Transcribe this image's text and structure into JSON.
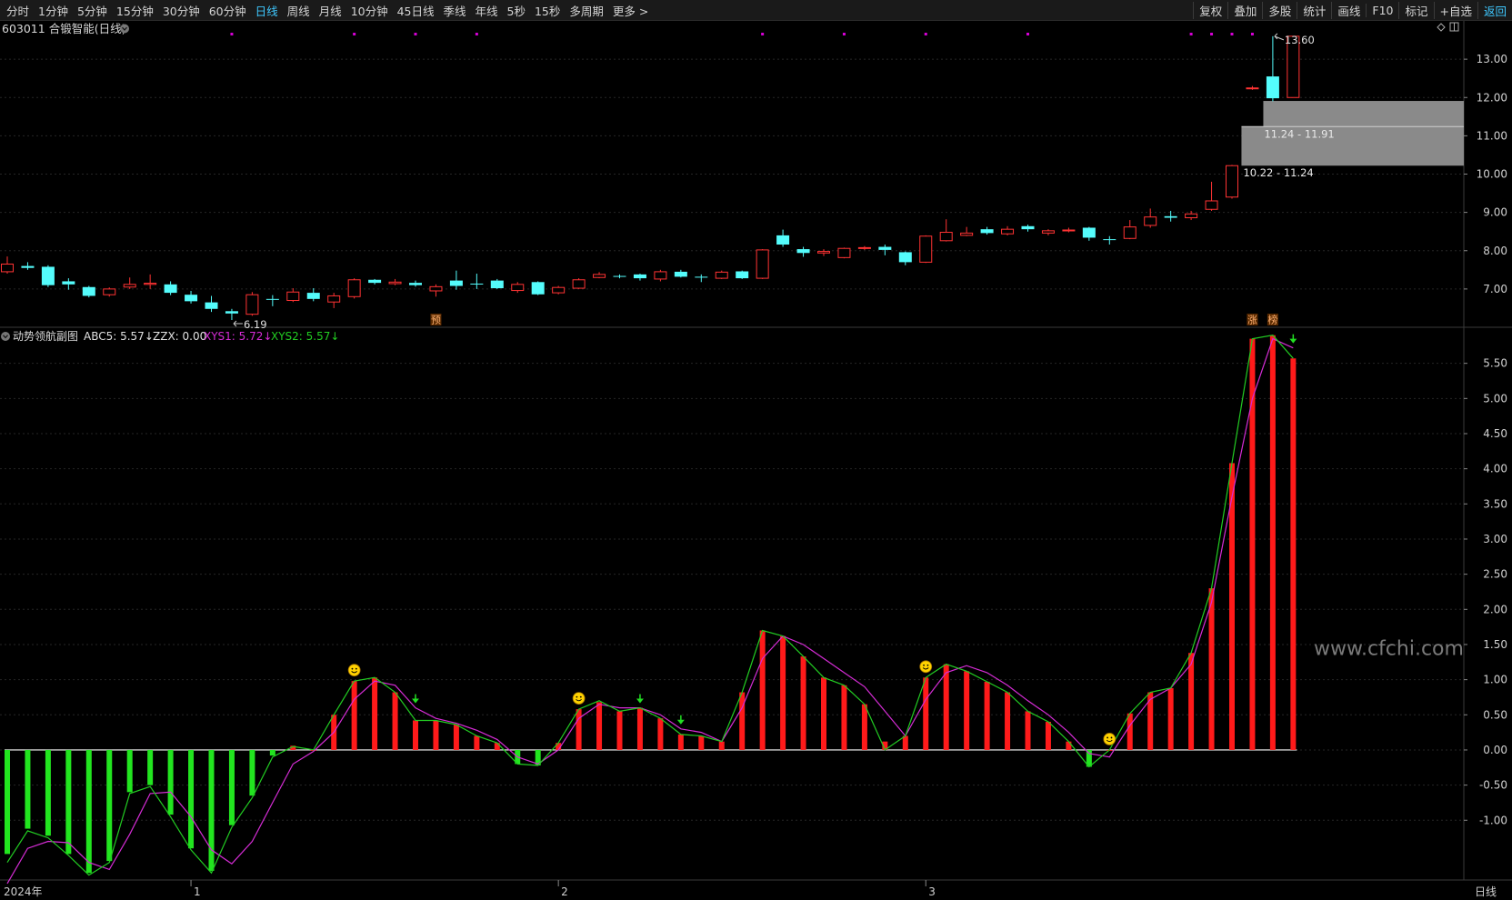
{
  "toolbar": {
    "timeframes": [
      "分时",
      "1分钟",
      "5分钟",
      "15分钟",
      "30分钟",
      "60分钟",
      "日线",
      "周线",
      "月线",
      "10分钟",
      "45日线",
      "季线",
      "年线",
      "5秒",
      "15秒",
      "多周期",
      "更多 >"
    ],
    "active_timeframe": "日线",
    "tools": [
      "复权",
      "叠加",
      "多股",
      "统计",
      "画线",
      "F10",
      "标记",
      "+自选",
      "返回"
    ]
  },
  "stock": {
    "title": "603011 合锻智能(日线)"
  },
  "colors": {
    "up": "#ff3333",
    "down": "#54fcfc",
    "bar_up": "#ff1a1a",
    "bar_down": "#22e51f",
    "xys1": "#d52cd5",
    "xys2": "#22cc22",
    "zero_line": "#ffffff",
    "grid": "#262626",
    "marker": "#d400d4"
  },
  "chart_data": [
    {
      "type": "candlestick",
      "title": "603011 合锻智能(日线)",
      "y_ticks": [
        "13.00",
        "12.00",
        "11.00",
        "10.00",
        "9.00",
        "8.00",
        "7.00"
      ],
      "y_ticks_values": [
        13,
        12,
        11,
        10,
        9,
        8,
        7
      ],
      "ylim": [
        6.0,
        14.0
      ],
      "candles": [
        {
          "o": 7.45,
          "c": 7.65,
          "h": 7.85,
          "l": 7.4
        },
        {
          "o": 7.6,
          "c": 7.55,
          "h": 7.7,
          "l": 7.5
        },
        {
          "o": 7.58,
          "c": 7.1,
          "h": 7.62,
          "l": 7.05
        },
        {
          "o": 7.2,
          "c": 7.12,
          "h": 7.28,
          "l": 6.98
        },
        {
          "o": 7.05,
          "c": 6.82,
          "h": 7.08,
          "l": 6.78
        },
        {
          "o": 6.85,
          "c": 7.0,
          "h": 7.04,
          "l": 6.8
        },
        {
          "o": 7.05,
          "c": 7.12,
          "h": 7.3,
          "l": 7.0
        },
        {
          "o": 7.12,
          "c": 7.15,
          "h": 7.38,
          "l": 7.0
        },
        {
          "o": 7.12,
          "c": 6.9,
          "h": 7.2,
          "l": 6.84
        },
        {
          "o": 6.85,
          "c": 6.68,
          "h": 6.95,
          "l": 6.62
        },
        {
          "o": 6.65,
          "c": 6.48,
          "h": 6.82,
          "l": 6.4
        },
        {
          "o": 6.42,
          "c": 6.36,
          "h": 6.48,
          "l": 6.19
        },
        {
          "o": 6.34,
          "c": 6.85,
          "h": 6.92,
          "l": 6.3
        },
        {
          "o": 6.74,
          "c": 6.72,
          "h": 6.84,
          "l": 6.55
        },
        {
          "o": 6.7,
          "c": 6.92,
          "h": 7.02,
          "l": 6.66
        },
        {
          "o": 6.9,
          "c": 6.74,
          "h": 7.02,
          "l": 6.68
        },
        {
          "o": 6.66,
          "c": 6.82,
          "h": 6.9,
          "l": 6.5
        },
        {
          "o": 6.8,
          "c": 7.24,
          "h": 7.28,
          "l": 6.75
        },
        {
          "o": 7.24,
          "c": 7.16,
          "h": 7.26,
          "l": 7.12
        },
        {
          "o": 7.14,
          "c": 7.18,
          "h": 7.26,
          "l": 7.1
        },
        {
          "o": 7.16,
          "c": 7.1,
          "h": 7.22,
          "l": 7.06
        },
        {
          "o": 6.95,
          "c": 7.06,
          "h": 7.12,
          "l": 6.8
        },
        {
          "o": 7.22,
          "c": 7.08,
          "h": 7.48,
          "l": 6.98
        },
        {
          "o": 7.14,
          "c": 7.12,
          "h": 7.4,
          "l": 7.0
        },
        {
          "o": 7.22,
          "c": 7.02,
          "h": 7.26,
          "l": 7.0
        },
        {
          "o": 6.96,
          "c": 7.12,
          "h": 7.18,
          "l": 6.9
        },
        {
          "o": 7.18,
          "c": 6.86,
          "h": 7.2,
          "l": 6.84
        },
        {
          "o": 6.9,
          "c": 7.04,
          "h": 7.08,
          "l": 6.86
        },
        {
          "o": 7.02,
          "c": 7.24,
          "h": 7.28,
          "l": 7.0
        },
        {
          "o": 7.3,
          "c": 7.38,
          "h": 7.44,
          "l": 7.28
        },
        {
          "o": 7.34,
          "c": 7.32,
          "h": 7.38,
          "l": 7.28
        },
        {
          "o": 7.38,
          "c": 7.28,
          "h": 7.4,
          "l": 7.22
        },
        {
          "o": 7.26,
          "c": 7.45,
          "h": 7.5,
          "l": 7.2
        },
        {
          "o": 7.45,
          "c": 7.32,
          "h": 7.5,
          "l": 7.3
        },
        {
          "o": 7.32,
          "c": 7.3,
          "h": 7.38,
          "l": 7.18
        },
        {
          "o": 7.28,
          "c": 7.44,
          "h": 7.48,
          "l": 7.26
        },
        {
          "o": 7.46,
          "c": 7.28,
          "h": 7.48,
          "l": 7.26
        },
        {
          "o": 7.28,
          "c": 8.02,
          "h": 8.04,
          "l": 7.26
        },
        {
          "o": 8.4,
          "c": 8.16,
          "h": 8.55,
          "l": 8.1
        },
        {
          "o": 8.04,
          "c": 7.94,
          "h": 8.1,
          "l": 7.84
        },
        {
          "o": 7.94,
          "c": 7.98,
          "h": 8.04,
          "l": 7.86
        },
        {
          "o": 7.82,
          "c": 8.06,
          "h": 8.08,
          "l": 7.8
        },
        {
          "o": 8.06,
          "c": 8.08,
          "h": 8.12,
          "l": 8.02
        },
        {
          "o": 8.1,
          "c": 8.02,
          "h": 8.16,
          "l": 7.88
        },
        {
          "o": 7.96,
          "c": 7.7,
          "h": 7.98,
          "l": 7.62
        },
        {
          "o": 7.7,
          "c": 8.38,
          "h": 8.4,
          "l": 7.68
        },
        {
          "o": 8.26,
          "c": 8.48,
          "h": 8.82,
          "l": 8.24
        },
        {
          "o": 8.4,
          "c": 8.46,
          "h": 8.62,
          "l": 8.38
        },
        {
          "o": 8.56,
          "c": 8.46,
          "h": 8.62,
          "l": 8.42
        },
        {
          "o": 8.44,
          "c": 8.56,
          "h": 8.64,
          "l": 8.4
        },
        {
          "o": 8.64,
          "c": 8.56,
          "h": 8.68,
          "l": 8.5
        },
        {
          "o": 8.46,
          "c": 8.52,
          "h": 8.56,
          "l": 8.4
        },
        {
          "o": 8.52,
          "c": 8.54,
          "h": 8.6,
          "l": 8.48
        },
        {
          "o": 8.6,
          "c": 8.34,
          "h": 8.62,
          "l": 8.26
        },
        {
          "o": 8.3,
          "c": 8.28,
          "h": 8.38,
          "l": 8.16
        },
        {
          "o": 8.32,
          "c": 8.62,
          "h": 8.8,
          "l": 8.3
        },
        {
          "o": 8.66,
          "c": 8.88,
          "h": 9.1,
          "l": 8.6
        },
        {
          "o": 8.9,
          "c": 8.86,
          "h": 9.04,
          "l": 8.76
        },
        {
          "o": 8.86,
          "c": 8.96,
          "h": 9.04,
          "l": 8.8
        },
        {
          "o": 9.08,
          "c": 9.3,
          "h": 9.8,
          "l": 9.04
        },
        {
          "o": 9.4,
          "c": 10.22,
          "h": 10.24,
          "l": 9.36
        },
        {
          "o": 12.25,
          "c": 12.25,
          "h": 12.3,
          "l": 12.2
        },
        {
          "o": 12.55,
          "c": 11.98,
          "h": 13.6,
          "l": 11.9
        },
        {
          "o": 12.0,
          "c": 13.6,
          "h": 13.6,
          "l": 12.0
        }
      ],
      "markers_top_indices": [
        11,
        17,
        20,
        23,
        37,
        41,
        45,
        50,
        58,
        59,
        60,
        61
      ],
      "annotations": [
        {
          "text": "6.19",
          "index": 11,
          "value": 6.19
        },
        {
          "text": "13.60",
          "index": 62,
          "value": 13.6
        },
        {
          "text": "11.24 - 11.91",
          "low": 11.24,
          "high": 11.91
        },
        {
          "text": "10.22 - 11.24",
          "low": 10.22,
          "high": 11.24
        }
      ],
      "badges": [
        {
          "text": "预",
          "index": 21
        },
        {
          "text": "涨",
          "index": 61
        },
        {
          "text": "榜",
          "index": 62
        }
      ]
    },
    {
      "type": "bar+line",
      "title": "动势领航副图",
      "legend": [
        {
          "name": "ABC5",
          "value": "5.57",
          "arrow": "↓"
        },
        {
          "name": "ZZX",
          "value": "0.00"
        },
        {
          "name": "XYS1",
          "value": "5.72",
          "arrow": "↓"
        },
        {
          "name": "XYS2",
          "value": "5.57",
          "arrow": "↓"
        }
      ],
      "y_ticks": [
        "5.50",
        "5.00",
        "4.50",
        "4.00",
        "3.50",
        "3.00",
        "2.50",
        "2.00",
        "1.50",
        "1.00",
        "0.50",
        "0.00",
        "-0.50",
        "-1.00"
      ],
      "y_ticks_values": [
        5.5,
        5.0,
        4.5,
        4.0,
        3.5,
        3.0,
        2.5,
        2.0,
        1.5,
        1.0,
        0.5,
        0.0,
        -0.5,
        -1.0
      ],
      "ylim": [
        -1.85,
        6.0
      ],
      "values": [
        -1.48,
        -1.12,
        -1.22,
        -1.48,
        -1.75,
        -1.58,
        -0.6,
        -0.5,
        -0.92,
        -1.4,
        -1.72,
        -1.07,
        -0.65,
        -0.08,
        0.06,
        0.0,
        0.5,
        0.98,
        1.03,
        0.82,
        0.42,
        0.42,
        0.36,
        0.2,
        0.1,
        -0.2,
        -0.22,
        0.1,
        0.58,
        0.68,
        0.55,
        0.6,
        0.45,
        0.22,
        0.2,
        0.12,
        0.82,
        1.7,
        1.62,
        1.33,
        1.03,
        0.92,
        0.65,
        0.12,
        0.2,
        1.03,
        1.22,
        1.12,
        0.97,
        0.82,
        0.55,
        0.4,
        0.12,
        -0.24,
        0.0,
        0.52,
        0.82,
        0.88,
        1.38,
        2.3,
        4.08,
        5.85,
        5.9,
        5.57
      ],
      "xys1": [
        -1.9,
        -1.4,
        -1.3,
        -1.32,
        -1.6,
        -1.7,
        -1.2,
        -0.62,
        -0.6,
        -0.95,
        -1.42,
        -1.62,
        -1.3,
        -0.75,
        -0.2,
        -0.02,
        0.25,
        0.72,
        0.98,
        0.92,
        0.6,
        0.45,
        0.38,
        0.28,
        0.15,
        -0.1,
        -0.2,
        0.0,
        0.45,
        0.65,
        0.6,
        0.6,
        0.5,
        0.3,
        0.25,
        0.12,
        0.6,
        1.3,
        1.62,
        1.5,
        1.3,
        1.1,
        0.9,
        0.55,
        0.2,
        0.72,
        1.1,
        1.2,
        1.1,
        0.92,
        0.7,
        0.5,
        0.25,
        -0.05,
        -0.1,
        0.35,
        0.72,
        0.88,
        1.22,
        2.1,
        3.6,
        5.0,
        5.85,
        5.72
      ],
      "xys2": [
        -1.6,
        -1.15,
        -1.25,
        -1.5,
        -1.78,
        -1.6,
        -0.62,
        -0.52,
        -0.95,
        -1.42,
        -1.75,
        -1.1,
        -0.68,
        -0.1,
        0.05,
        0.0,
        0.5,
        0.98,
        1.03,
        0.82,
        0.42,
        0.42,
        0.36,
        0.2,
        0.1,
        -0.2,
        -0.22,
        0.1,
        0.58,
        0.7,
        0.55,
        0.6,
        0.45,
        0.22,
        0.2,
        0.12,
        0.82,
        1.7,
        1.62,
        1.33,
        1.03,
        0.92,
        0.65,
        0.0,
        0.2,
        1.03,
        1.22,
        1.12,
        0.97,
        0.82,
        0.55,
        0.4,
        0.12,
        -0.24,
        0.0,
        0.52,
        0.82,
        0.88,
        1.38,
        2.3,
        4.08,
        5.85,
        5.9,
        5.57
      ],
      "smile_indices": [
        17,
        28,
        45,
        54
      ],
      "down_arrow_indices": [
        20,
        31,
        33,
        63
      ],
      "watermark": "www.cfchi.com"
    }
  ],
  "time_axis": {
    "labels": [
      {
        "text": "2024年",
        "index": 0
      },
      {
        "text": "1",
        "index": 9
      },
      {
        "text": "2",
        "index": 27
      },
      {
        "text": "3",
        "index": 45
      }
    ],
    "period": "日线"
  }
}
